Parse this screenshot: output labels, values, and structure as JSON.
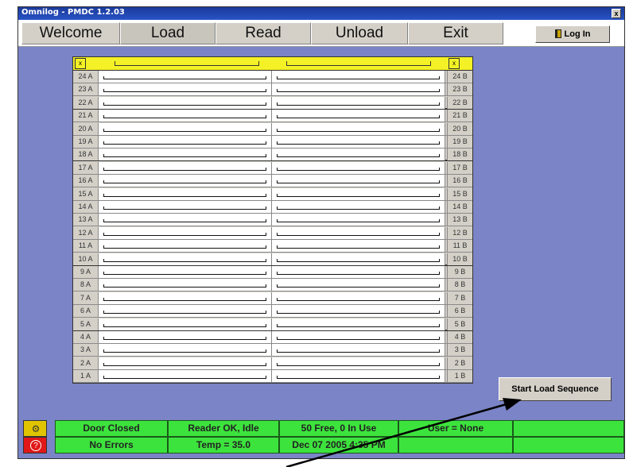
{
  "window": {
    "title": "Omnilog - PMDC 1.2.03",
    "close_label": "x"
  },
  "menu": {
    "tabs": [
      {
        "label": "Welcome"
      },
      {
        "label": "Load"
      },
      {
        "label": "Read"
      },
      {
        "label": "Unload"
      },
      {
        "label": "Exit"
      }
    ],
    "login_label": "Log In"
  },
  "grid": {
    "corner_label": "x",
    "left_labels": [
      "24 A",
      "23 A",
      "22 A",
      "21 A",
      "20 A",
      "19 A",
      "18 A",
      "17 A",
      "16 A",
      "15 A",
      "14 A",
      "13 A",
      "12 A",
      "11 A",
      "10 A",
      "9 A",
      "8 A",
      "7 A",
      "6 A",
      "5 A",
      "4 A",
      "3 A",
      "2 A",
      "1 A"
    ],
    "right_labels": [
      "24 B",
      "23 B",
      "22 B",
      "21 B",
      "20 B",
      "19 B",
      "18 B",
      "17 B",
      "16 B",
      "15 B",
      "14 B",
      "13 B",
      "12 B",
      "11 B",
      "10 B",
      "9 B",
      "8 B",
      "7 B",
      "6 B",
      "5 B",
      "4 B",
      "3 B",
      "2 B",
      "1 B"
    ]
  },
  "actions": {
    "start_load": "Start Load Sequence"
  },
  "status": {
    "row1": [
      "Door Closed",
      "Reader OK, Idle",
      "50 Free, 0 In Use",
      "User = None",
      ""
    ],
    "row2": [
      "No Errors",
      "Temp = 35.0",
      "Dec 07 2005 4:35 PM",
      "",
      ""
    ]
  },
  "colors": {
    "background": "#7b84c6",
    "header_yellow": "#f4f126",
    "status_green": "#3de33d",
    "error_red": "#e01818"
  },
  "icons": [
    "gear-icon",
    "error-icon",
    "door-icon",
    "close-icon"
  ]
}
